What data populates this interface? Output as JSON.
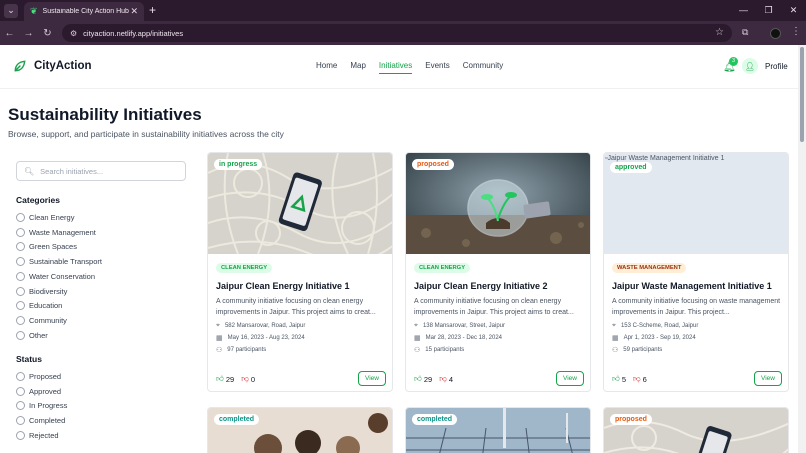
{
  "browser": {
    "tab_title": "Sustainable City Action Hub",
    "url": "cityaction.netlify.app/initiatives"
  },
  "header": {
    "brand": "CityAction",
    "nav": [
      "Home",
      "Map",
      "Initiatives",
      "Events",
      "Community"
    ],
    "active_nav": "Initiatives",
    "notification_count": "3",
    "profile_label": "Profile"
  },
  "page": {
    "title": "Sustainability Initiatives",
    "subtitle": "Browse, support, and participate in sustainability initiatives across the city"
  },
  "sidebar": {
    "search_placeholder": "Search initiatives...",
    "categories_title": "Categories",
    "categories": [
      "Clean Energy",
      "Waste Management",
      "Green Spaces",
      "Sustainable Transport",
      "Water Conservation",
      "Biodiversity",
      "Education",
      "Community",
      "Other"
    ],
    "status_title": "Status",
    "statuses": [
      "Proposed",
      "Approved",
      "In Progress",
      "Completed",
      "Rejected"
    ]
  },
  "cards": [
    {
      "status": "in progress",
      "category": "CLEAN ENERGY",
      "title": "Jaipur Clean Energy Initiative 1",
      "description": "A community initiative focusing on clean energy improvements in Jaipur. This project aims to creat...",
      "address": "582 Mansarovar, Road, Jaipur",
      "dates": "May 16, 2023 - Aug 23, 2024",
      "participants": "97 participants",
      "upvotes": "29",
      "downvotes": "0",
      "view_label": "View"
    },
    {
      "status": "proposed",
      "category": "CLEAN ENERGY",
      "title": "Jaipur Clean Energy Initiative 2",
      "description": "A community initiative focusing on clean energy improvements in Jaipur. This project aims to creat...",
      "address": "138 Mansarovar, Street, Jaipur",
      "dates": "Mar 28, 2023 - Dec 18, 2024",
      "participants": "15 participants",
      "upvotes": "29",
      "downvotes": "4",
      "view_label": "View"
    },
    {
      "status": "approved",
      "image_alt": "Jaipur Waste Management Initiative 1",
      "category": "WASTE MANAGEMENT",
      "title": "Jaipur Waste Management Initiative 1",
      "description": "A community initiative focusing on waste management improvements in Jaipur. This project...",
      "address": "153 C-Scheme, Road, Jaipur",
      "dates": "Apr 1, 2023 - Sep 19, 2024",
      "participants": "59 participants",
      "upvotes": "5",
      "downvotes": "6",
      "view_label": "View"
    }
  ],
  "next_row_statuses": [
    "completed",
    "completed",
    "proposed"
  ],
  "colors": {
    "accent": "#16a34a",
    "status_in_progress": "#16a34a",
    "status_proposed": "#ea580c",
    "status_approved": "#16a34a",
    "status_completed": "#0d9488"
  }
}
